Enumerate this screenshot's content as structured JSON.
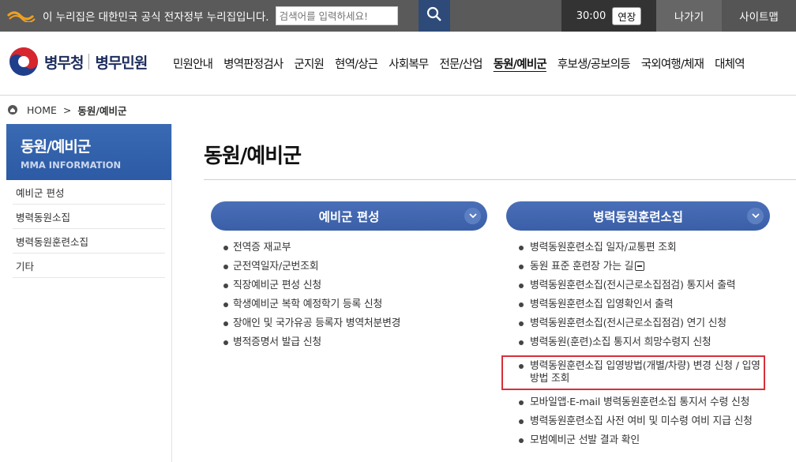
{
  "gov_bar": {
    "notice": "이 누리집은 대한민국 공식 전자정부 누리집입니다.",
    "search_placeholder": "검색어를 입력하세요!",
    "timer": "30:00",
    "extend_label": "연장",
    "logout_label": "나가기",
    "sitemap_label": "사이트맵"
  },
  "header": {
    "org_name": "병무청",
    "service_name": "병무민원",
    "nav": [
      "민원안내",
      "병역판정검사",
      "군지원",
      "현역/상근",
      "사회복무",
      "전문/산업",
      "동원/예비군",
      "후보생/공보의등",
      "국외여행/체재",
      "대체역"
    ],
    "active_nav": "동원/예비군"
  },
  "breadcrumb": {
    "home": "HOME",
    "separator": ">",
    "current": "동원/예비군"
  },
  "sidebar": {
    "title": "동원/예비군",
    "subtitle": "MMA INFORMATION",
    "items": [
      "예비군 편성",
      "병력동원소집",
      "병력동원훈련소집",
      "기타"
    ]
  },
  "main": {
    "title": "동원/예비군",
    "sections": [
      {
        "heading": "예비군 편성",
        "items": [
          "전역증 재교부",
          "군전역일자/군번조회",
          "직장예비군 편성 신청",
          "학생예비군 복학 예정학기 등록 신청",
          "장애인 및 국가유공 등록자 병역처분변경",
          "병적증명서 발급 신청"
        ]
      },
      {
        "heading": "병력동원훈련소집",
        "items": [
          "병력동원훈련소집 일자/교통편 조회",
          "동원 표준 훈련장 가는 길",
          "병력동원훈련소집(전시근로소집점검) 통지서 출력",
          "병력동원훈련소집 입영확인서 출력",
          "병력동원훈련소집(전시근로소집점검) 연기 신청",
          "병력동원(훈련)소집 통지서 희망수령지 신청",
          "병력동원훈련소집 입영방법(개별/차량) 변경 신청 / 입영방법 조회",
          "모바일앱·E-mail 병력동원훈련소집 통지서 수령 신청",
          "병력동원훈련소집 사전 여비 및 미수령 여비 지급 신청",
          "모범예비군 선발 결과 확인"
        ]
      }
    ]
  },
  "colors": {
    "gov_bar_bg": "#5a5a5a",
    "accent_blue": "#3a5fa8",
    "highlight_red": "#d8303a"
  }
}
